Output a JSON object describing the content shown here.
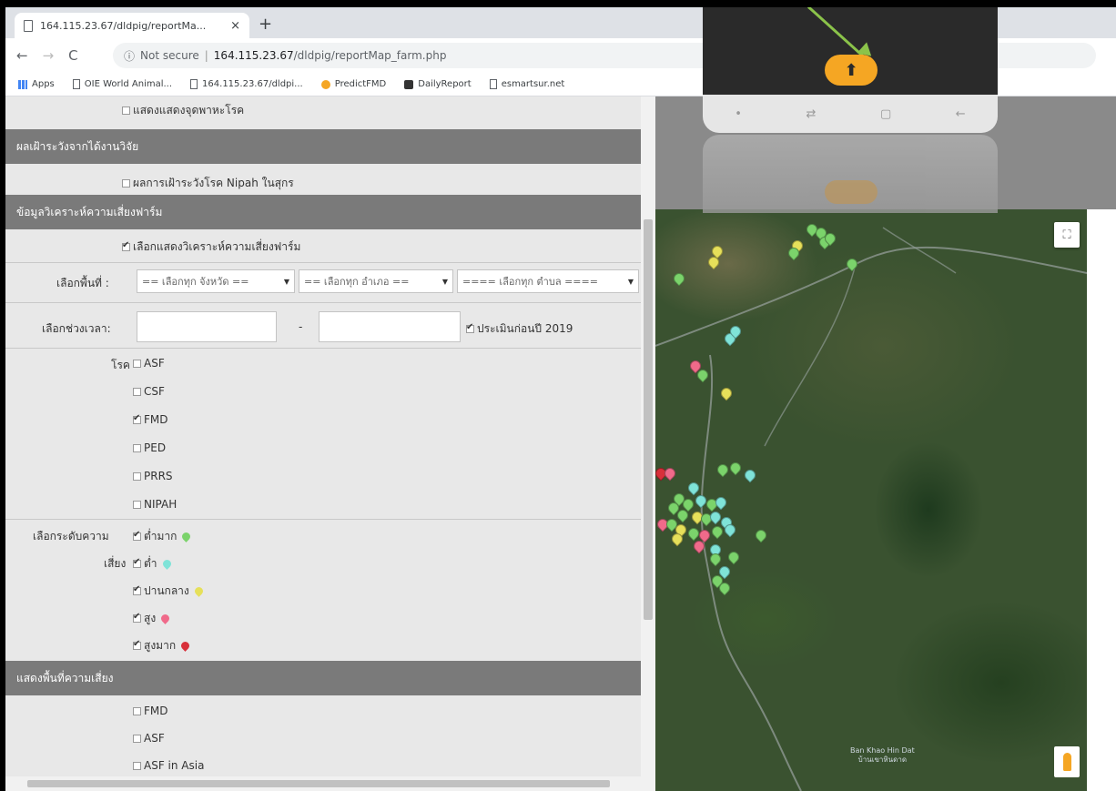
{
  "browser": {
    "tab_title": "164.115.23.67/dldpig/reportMa...",
    "new_tab": "+",
    "tab_close": "×",
    "security": "Not secure",
    "url_host": "164.115.23.67",
    "url_path": "/dldpig/reportMap_farm.php",
    "bookmarks": [
      "Apps",
      "OIE World Animal...",
      "164.115.23.67/dldpi...",
      "PredictFMD",
      "DailyReport",
      "esmartsur.net"
    ]
  },
  "panel": {
    "top_item": "แสดงแสดงจุดพาหะโรค",
    "section_surveillance": "ผลเฝ้าระวังจากได้งานวิจัย",
    "nipah_item": "ผลการเฝ้าระวังโรค Nipah ในสุกร",
    "section_risk": "ข้อมูลวิเคราะห์ความเสี่ยงฟาร์ม",
    "risk_toggle": "เลือกแสดงวิเคราะห์ความเสี่ยงฟาร์ม",
    "area_label": "เลือกพื้นที่ :",
    "province_select": "== เลือกทุก จังหวัด ==",
    "district_select": "== เลือกทุก อำเภอ ==",
    "subdistrict_select": "==== เลือกทุก ตำบล ====",
    "period_label": "เลือกช่วงเวลา:",
    "period_dash": "-",
    "before_year": "ประเมินก่อนปี 2019",
    "disease_label": "โรค",
    "diseases": [
      {
        "name": "ASF",
        "checked": false
      },
      {
        "name": "CSF",
        "checked": false
      },
      {
        "name": "FMD",
        "checked": true
      },
      {
        "name": "PED",
        "checked": false
      },
      {
        "name": "PRRS",
        "checked": false
      },
      {
        "name": "NIPAH",
        "checked": false
      }
    ],
    "risk_level_label_1": "เลือกระดับความ",
    "risk_level_label_2": "เสี่ยง",
    "risk_levels": [
      {
        "name": "ต่ำมาก",
        "color": "#7bd36b"
      },
      {
        "name": "ต่ำ",
        "color": "#7fe3d8"
      },
      {
        "name": "ปานกลาง",
        "color": "#e6e05a"
      },
      {
        "name": "สูง",
        "color": "#f06a8a"
      },
      {
        "name": "สูงมาก",
        "color": "#d8303a"
      }
    ],
    "section_area": "แสดงพื้นที่ความเสี่ยง",
    "area_layers": [
      "FMD",
      "ASF",
      "ASF in Asia"
    ]
  },
  "map": {
    "place_label_1": "Ban Khao Hin Dat",
    "place_label_2": "บ้านเขาหินดาด",
    "fullscreen_icon": "fullscreen-icon",
    "pegman_icon": "pegman-icon"
  },
  "overlay": {
    "cloud_icon": "cloud-upload-icon",
    "cloud_glyph": "⬆"
  }
}
